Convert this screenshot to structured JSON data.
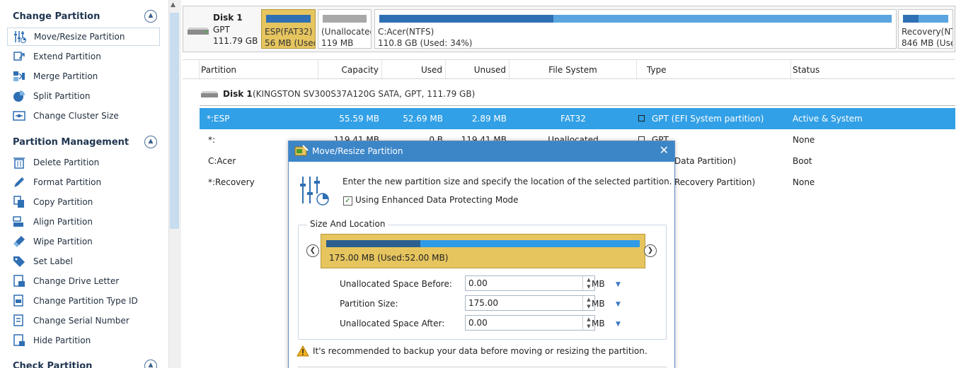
{
  "sidebar": {
    "sections": [
      {
        "title": "Change Partition",
        "items": [
          {
            "label": "Move/Resize Partition",
            "icon": "sliders-icon",
            "active": true
          },
          {
            "label": "Extend Partition",
            "icon": "extend-icon"
          },
          {
            "label": "Merge Partition",
            "icon": "merge-icon"
          },
          {
            "label": "Split Partition",
            "icon": "pie-split-icon"
          },
          {
            "label": "Change Cluster Size",
            "icon": "cluster-icon"
          }
        ]
      },
      {
        "title": "Partition Management",
        "items": [
          {
            "label": "Delete Partition",
            "icon": "trash-icon"
          },
          {
            "label": "Format Partition",
            "icon": "pencil-icon"
          },
          {
            "label": "Copy Partition",
            "icon": "copy-icon"
          },
          {
            "label": "Align Partition",
            "icon": "align-icon"
          },
          {
            "label": "Wipe Partition",
            "icon": "wipe-icon"
          },
          {
            "label": "Set Label",
            "icon": "tag-icon"
          },
          {
            "label": "Change Drive Letter",
            "icon": "drive-letter-icon"
          },
          {
            "label": "Change Partition Type ID",
            "icon": "type-id-icon"
          },
          {
            "label": "Change Serial Number",
            "icon": "serial-icon"
          },
          {
            "label": "Hide Partition",
            "icon": "hide-icon"
          }
        ]
      },
      {
        "title": "Check Partition",
        "items": []
      }
    ]
  },
  "diskmap": {
    "disk": {
      "name": "Disk 1",
      "style": "GPT",
      "size": "111.79 GB"
    },
    "partitions": [
      {
        "line1": "ESP(FAT32)",
        "line2": "56 MB (Used",
        "selected": true,
        "used_fraction": 1.0,
        "bar_color": "#2f6fb3"
      },
      {
        "line1": "(Unallocated",
        "line2": "119 MB",
        "selected": false,
        "used_fraction": 1.0,
        "bar_color": "#a8a8a8"
      },
      {
        "line1": "C:Acer(NTFS)",
        "line2": "110.8 GB (Used: 34%)",
        "selected": false,
        "used_fraction": 0.34,
        "bar_color": "#2f6fb3"
      },
      {
        "line1": "Recovery(NT",
        "line2": "846 MB (Use",
        "selected": false,
        "used_fraction": 0.35,
        "bar_color": "#2f6fb3"
      }
    ]
  },
  "table": {
    "headers": [
      "Partition",
      "Capacity",
      "Used",
      "Unused",
      "File System",
      "Type",
      "Status"
    ],
    "disk_label": "Disk 1",
    "disk_detail": "(KINGSTON SV300S37A120G SATA, GPT, 111.79 GB)",
    "rows": [
      {
        "partition": "*:ESP",
        "capacity": "55.59 MB",
        "used": "52.69 MB",
        "unused": "2.89 MB",
        "fs": "FAT32",
        "type": "GPT (EFI System partition)",
        "status": "Active & System",
        "selected": true
      },
      {
        "partition": "*:",
        "capacity": "119.41 MB",
        "used": "0 B",
        "unused": "119.41 MB",
        "fs": "Unallocated",
        "type": "GPT",
        "status": "None",
        "selected": false
      },
      {
        "partition": "C:Acer",
        "capacity": "",
        "used": "",
        "unused": "",
        "fs": "",
        "type": "Data Partition)",
        "status": "Boot",
        "selected": false
      },
      {
        "partition": "*:Recovery",
        "capacity": "",
        "used": "",
        "unused": "",
        "fs": "",
        "type": "Recovery Partition)",
        "status": "None",
        "selected": false
      }
    ]
  },
  "dialog": {
    "title": "Move/Resize Partition",
    "instruction": "Enter the new partition size and specify the location of the selected partition.",
    "checkbox_label": "Using Enhanced Data Protecting Mode",
    "checkbox_checked": true,
    "group_title": "Size And Location",
    "partition_block_text": "175.00 MB (Used:52.00 MB)",
    "partition_used_fraction": 0.3,
    "fields": [
      {
        "label": "Unallocated Space Before:",
        "value": "0.00",
        "unit": "MB"
      },
      {
        "label": "Partition Size:",
        "value": "175.00",
        "unit": "MB"
      },
      {
        "label": "Unallocated Space After:",
        "value": "0.00",
        "unit": "MB"
      }
    ],
    "warning": "It's recommended to backup your data before moving or resizing the partition."
  },
  "colors": {
    "accent": "#3c86c8",
    "selection": "#32a0e6",
    "partition_gold": "#e6c55f",
    "used_bar": "#2f6fb3"
  }
}
